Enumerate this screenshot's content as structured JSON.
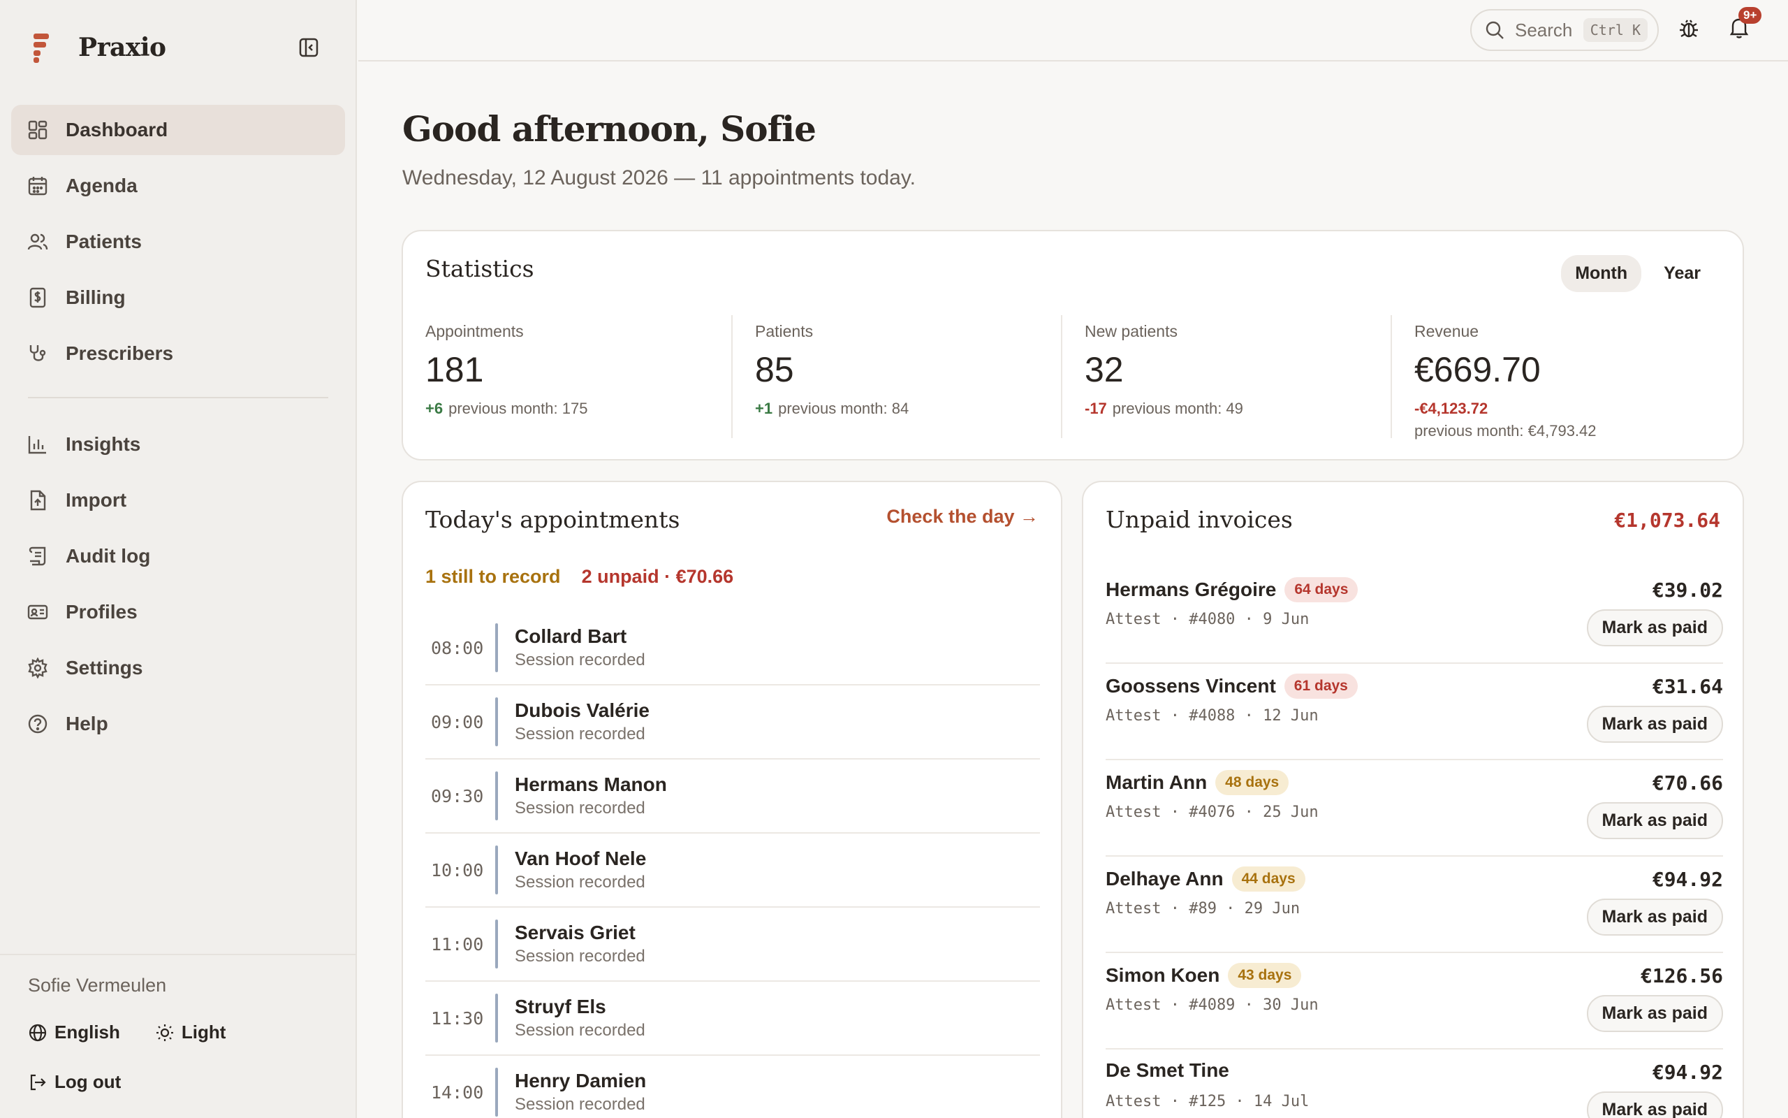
{
  "brand": {
    "name": "Praxio"
  },
  "sidebar": {
    "items": [
      {
        "label": "Dashboard",
        "icon": "dashboard-icon"
      },
      {
        "label": "Agenda",
        "icon": "calendar-icon"
      },
      {
        "label": "Patients",
        "icon": "users-icon"
      },
      {
        "label": "Billing",
        "icon": "invoice-icon"
      },
      {
        "label": "Prescribers",
        "icon": "stethoscope-icon"
      },
      {
        "label": "Insights",
        "icon": "bar-chart-icon"
      },
      {
        "label": "Import",
        "icon": "file-upload-icon"
      },
      {
        "label": "Audit log",
        "icon": "scroll-icon"
      },
      {
        "label": "Profiles",
        "icon": "id-card-icon"
      },
      {
        "label": "Settings",
        "icon": "gear-icon"
      },
      {
        "label": "Help",
        "icon": "help-icon"
      }
    ],
    "active": "Dashboard",
    "user_name": "Sofie Vermeulen",
    "language": "English",
    "theme": "Light",
    "logout": "Log out"
  },
  "topbar": {
    "search_placeholder": "Search",
    "search_shortcut": "Ctrl K",
    "notification_badge": "9+"
  },
  "main": {
    "greeting": "Good afternoon, Sofie",
    "subline": "Wednesday, 12 August 2026 — 11 appointments today."
  },
  "stats": {
    "title": "Statistics",
    "period_month": "Month",
    "period_year": "Year",
    "items": [
      {
        "label": "Appointments",
        "value": "181",
        "delta": "+6",
        "prev": "previous month: 175"
      },
      {
        "label": "Patients",
        "value": "85",
        "delta": "+1",
        "prev": "previous month: 84"
      },
      {
        "label": "New patients",
        "value": "32",
        "delta": "-17",
        "prev": "previous month: 49"
      },
      {
        "label": "Revenue",
        "value": "€669.70",
        "delta": "-€4,123.72",
        "prev": "previous month: €4,793.42"
      }
    ]
  },
  "appointments": {
    "title": "Today's appointments",
    "check_day": "Check the day →",
    "tag_record": "1 still to record",
    "tag_unpaid": "2 unpaid · €70.66",
    "rows": [
      {
        "time": "08:00",
        "name": "Collard Bart",
        "status": "Session recorded"
      },
      {
        "time": "09:00",
        "name": "Dubois Valérie",
        "status": "Session recorded"
      },
      {
        "time": "09:30",
        "name": "Hermans Manon",
        "status": "Session recorded"
      },
      {
        "time": "10:00",
        "name": "Van Hoof Nele",
        "status": "Session recorded"
      },
      {
        "time": "11:00",
        "name": "Servais Griet",
        "status": "Session recorded"
      },
      {
        "time": "11:30",
        "name": "Struyf Els",
        "status": "Session recorded"
      },
      {
        "time": "14:00",
        "name": "Henry Damien",
        "status": "Session recorded"
      }
    ]
  },
  "invoices": {
    "title": "Unpaid invoices",
    "total": "€1,073.64",
    "mark_label": "Mark as paid",
    "rows": [
      {
        "name": "Hermans Grégoire",
        "days": "64 days",
        "level": "red",
        "meta": "Attest · #4080 · 9 Jun",
        "amount": "€39.02"
      },
      {
        "name": "Goossens Vincent",
        "days": "61 days",
        "level": "red",
        "meta": "Attest · #4088 · 12 Jun",
        "amount": "€31.64"
      },
      {
        "name": "Martin Ann",
        "days": "48 days",
        "level": "amber",
        "meta": "Attest · #4076 · 25 Jun",
        "amount": "€70.66"
      },
      {
        "name": "Delhaye Ann",
        "days": "44 days",
        "level": "amber",
        "meta": "Attest · #89 · 29 Jun",
        "amount": "€94.92"
      },
      {
        "name": "Simon Koen",
        "days": "43 days",
        "level": "amber",
        "meta": "Attest · #4089 · 30 Jun",
        "amount": "€126.56"
      },
      {
        "name": "De Smet Tine",
        "days": "",
        "level": "",
        "meta": "Attest · #125 · 14 Jul",
        "amount": "€94.92"
      }
    ]
  },
  "colors": {
    "accent": "#b4502f",
    "positive": "#3a7a44",
    "negative": "#b5362d",
    "warning": "#a8720f"
  }
}
